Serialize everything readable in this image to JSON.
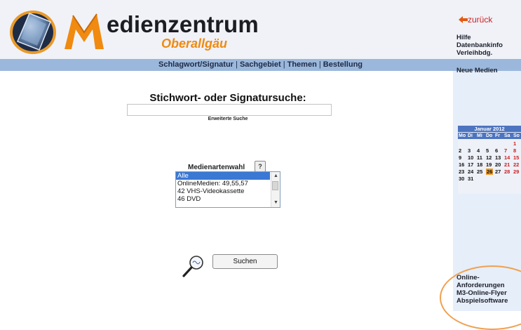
{
  "header": {
    "brand_line1": "edienzentrum",
    "brand_line2": "Oberallgäu",
    "accent_color": "#f08a10"
  },
  "nav": {
    "items": [
      "Schlagwort/Signatur",
      "Sachgebiet",
      "Themen",
      "Bestellung"
    ],
    "separator": "|"
  },
  "search": {
    "title": "Stichwort- oder Signatursuche:",
    "input_value": "",
    "advanced_link": "Erweiterte Suche"
  },
  "media_types": {
    "label": "Medienartenwahl",
    "help_label": "?",
    "options": [
      "Alle",
      "OnlineMedien: 49,55,57",
      "42 VHS-Videokassette",
      "46 DVD"
    ],
    "selected": "Alle"
  },
  "submit": {
    "label": "Suchen",
    "icon": "magnifier-m3-icon"
  },
  "sidebar": {
    "back_label": "zurück",
    "back_icon": "arrow-left-icon",
    "links": [
      "Hilfe",
      "Datenbankinfo",
      "Verleihbdg."
    ],
    "news_link": "Neue Medien",
    "bottom_links": [
      "Online-",
      "Anforderungen",
      "M3-Online-Flyer",
      "Abspielsoftware"
    ]
  },
  "calendar": {
    "month_label": "Januar 2012",
    "weekdays": [
      "Mo",
      "Di",
      "Mi",
      "Do",
      "Fr",
      "Sa",
      "So"
    ],
    "weeks": [
      [
        "",
        "",
        "",
        "",
        "",
        "",
        "1"
      ],
      [
        "2",
        "3",
        "4",
        "5",
        "6",
        "7",
        "8"
      ],
      [
        "9",
        "10",
        "11",
        "12",
        "13",
        "14",
        "15"
      ],
      [
        "16",
        "17",
        "18",
        "19",
        "20",
        "21",
        "22"
      ],
      [
        "23",
        "24",
        "25",
        "26",
        "27",
        "28",
        "29"
      ],
      [
        "30",
        "31",
        "",
        "",
        "",
        "",
        ""
      ]
    ],
    "today": "26",
    "header_color": "#4d74bf",
    "weekend_color": "#cc2020",
    "today_color": "#f19a25"
  }
}
